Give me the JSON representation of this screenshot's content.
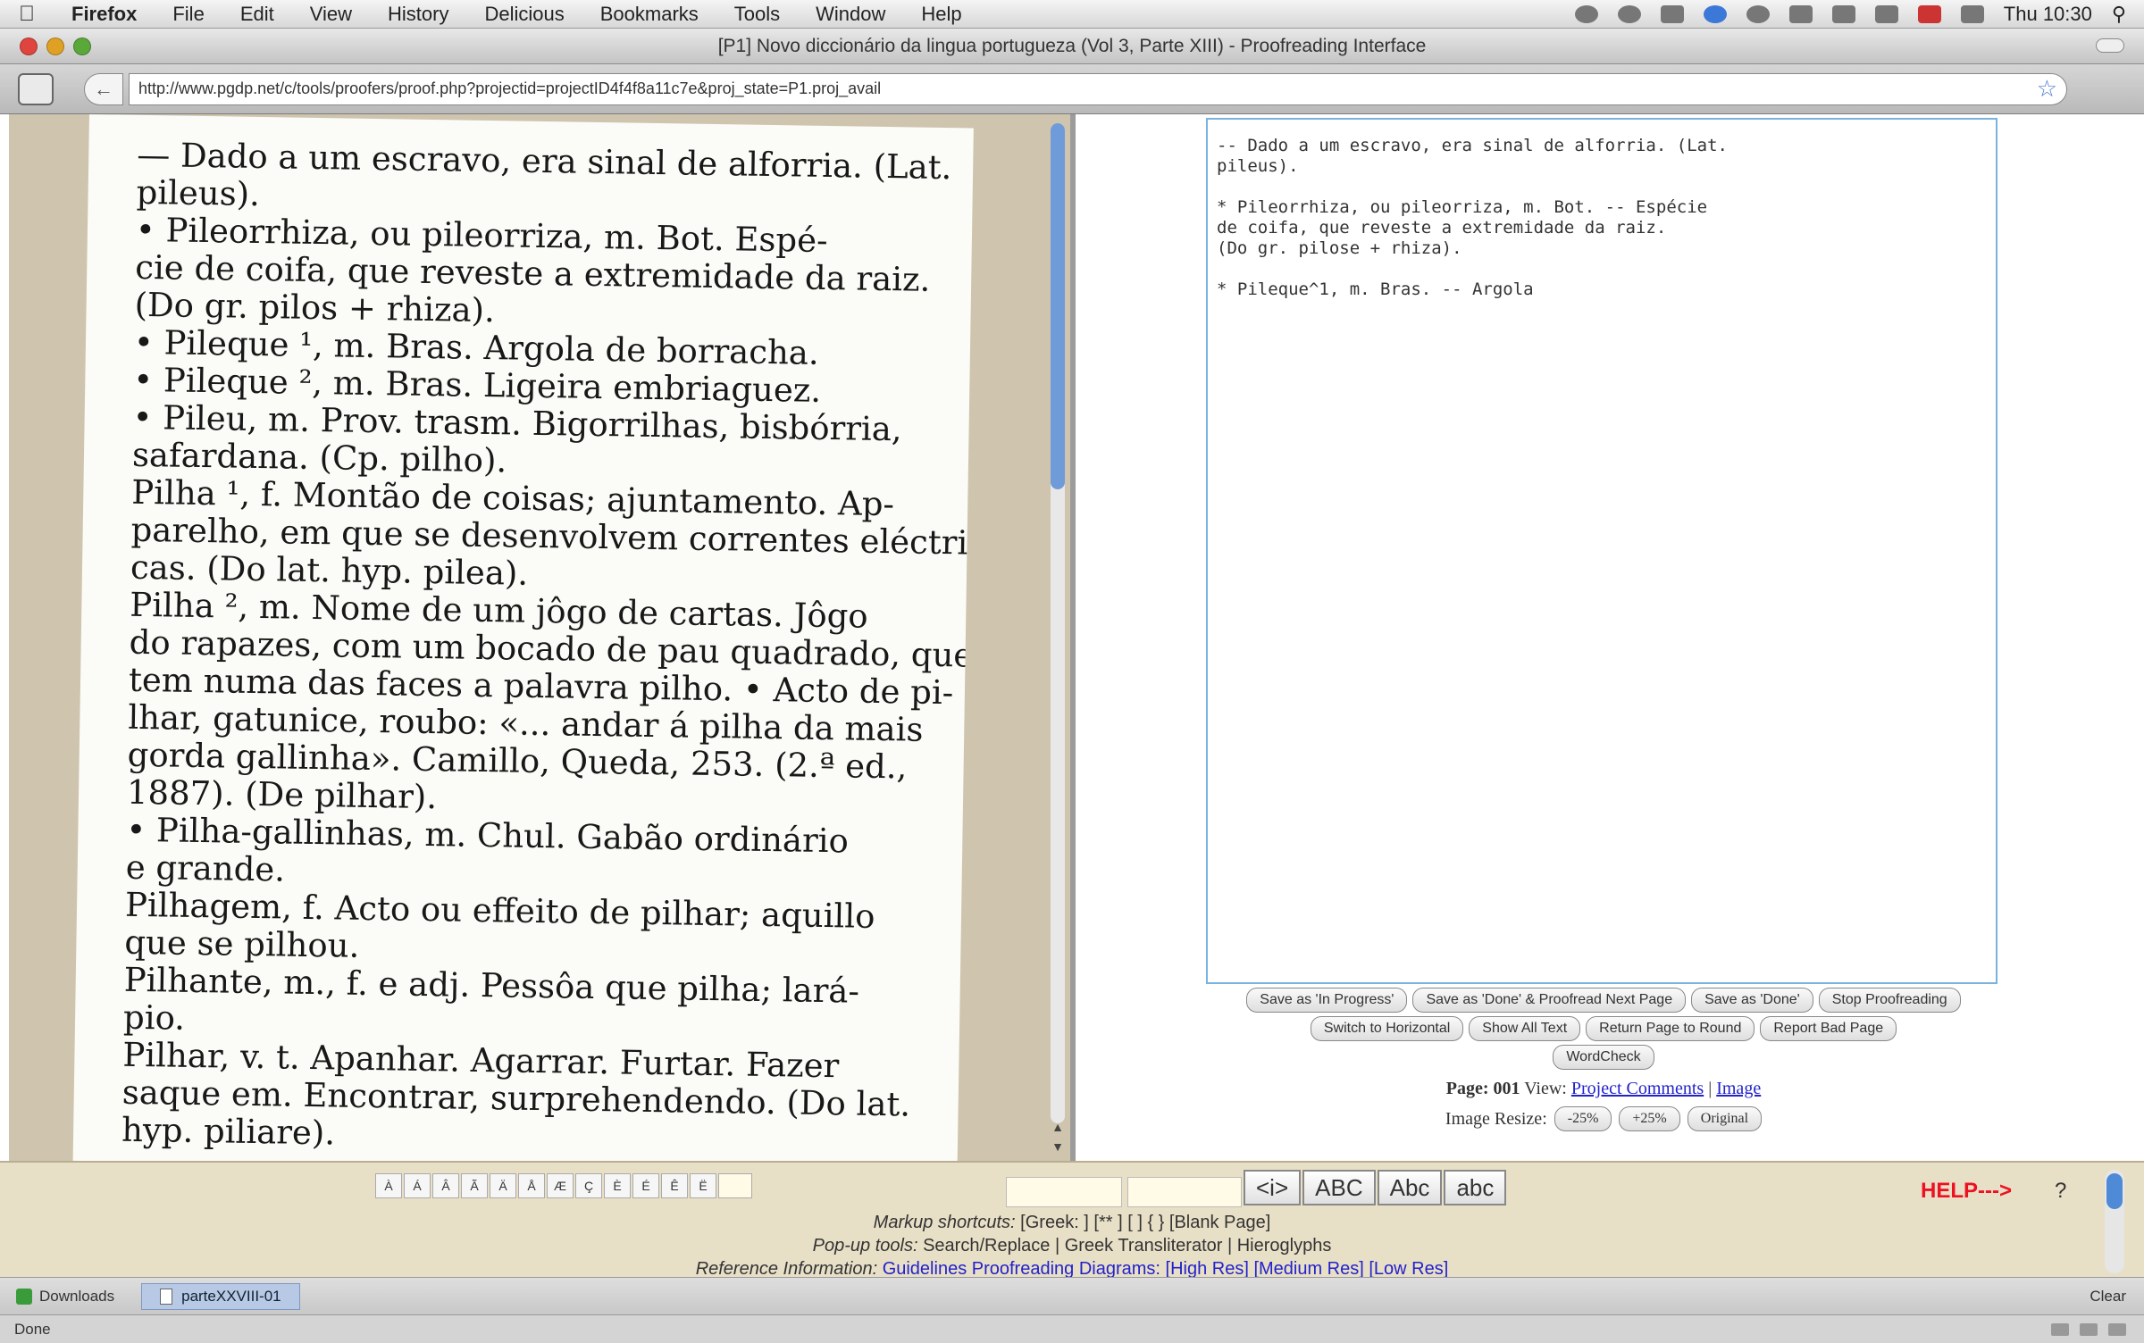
{
  "menubar": {
    "app_name": "Firefox",
    "items": [
      "File",
      "Edit",
      "View",
      "History",
      "Delicious",
      "Bookmarks",
      "Tools",
      "Window",
      "Help"
    ],
    "clock": "Thu 10:30"
  },
  "window": {
    "title": "[P1] Novo diccionário da lingua portugueza (Vol 3, Parte XIII) - Proofreading Interface"
  },
  "toolbar": {
    "url": "http://www.pgdp.net/c/tools/proofers/proof.php?projectid=projectID4f4f8a11c7e&proj_state=P1.proj_avail"
  },
  "scan": {
    "lines": [
      "— Dado a um escravo, era sinal de alforria. (Lat.",
      "pileus).",
      "  • Pileorrhiza, ou pileorriza, m. Bot. Espé-",
      "cie de coifa, que reveste a extremidade da raiz.",
      "(Do gr. pilos + rhiza).",
      "  • Pileque ¹, m. Bras. Argola de borracha.",
      "  • Pileque ², m. Bras. Ligeira embriaguez.",
      "  • Pileu, m. Prov. trasm. Bigorrilhas, bisbórria,",
      "safardana. (Cp. pilho).",
      "   Pilha ¹, f. Montão de coisas; ajuntamento. Ap-",
      "parelho, em que se desenvolvem correntes eléctri-",
      "cas. (Do lat. hyp. pilea).",
      "   Pilha ², m. Nome de um jôgo de cartas. Jôgo",
      "do rapazes, com um bocado de pau quadrado, que",
      "tem numa das faces a palavra pilho. • Acto de pi-",
      "lhar, gatunice, roubo: «... andar á pilha da mais",
      "gorda gallinha». Camillo, Queda, 253. (2.ª ed.,",
      "1887). (De pilhar).",
      "  • Pilha-gallinhas, m. Chul. Gabão ordinário",
      "e grande.",
      "   Pilhagem, f. Acto ou effeito de pilhar; aquillo",
      "que se pilhou.",
      "   Pilhante, m., f. e adj. Pessôa que pilha; lará-",
      "pio.",
      "   Pilhar, v. t. Apanhar. Agarrar. Furtar. Fazer",
      "saque em. Encontrar, surprehendendo. (Do lat.",
      "hyp. piliare)."
    ]
  },
  "editor": {
    "lines": [
      "-- Dado a um escravo, era sinal de alforria. (Lat.",
      "pileus).",
      "",
      "* Pileorrhiza, ou pileorriza, m. Bot. -- Espécie",
      "de coifa, que reveste a extremidade da raiz.",
      "(Do gr. pilose + rhiza).",
      "",
      "* Pileque^1, m. Bras. -- Argola"
    ]
  },
  "buttons": {
    "row1": [
      "Save as 'In Progress'",
      "Save as 'Done' & Proofread Next Page",
      "Save as 'Done'",
      "Stop Proofreading"
    ],
    "row2": [
      "Switch to Horizontal",
      "Show All Text",
      "Return Page to Round",
      "Report Bad Page"
    ],
    "row3": [
      "WordCheck"
    ]
  },
  "page_info": {
    "page_label": "Page: 001",
    "view_label": "View:",
    "project_comments": "Project Comments",
    "separator": "|",
    "image_link": "Image",
    "resize_label": "Image Resize:",
    "resize_buttons": [
      "-25%",
      "+25%",
      "Original"
    ]
  },
  "toolbox": {
    "chars": [
      "À",
      "Á",
      "Â",
      "Ã",
      "Ä",
      "Å",
      "Æ",
      "Ç",
      "È",
      "É",
      "Ê",
      "Ë",
      ""
    ],
    "case_buttons": [
      "<i>",
      "ABC",
      "Abc",
      "abc"
    ],
    "help_link": "HELP--->",
    "help_q": "?",
    "markup_label": "Markup shortcuts:",
    "markup_items": "[Greek: ]   [** ]   [ ]   { }   [Blank Page]",
    "popup_label": "Pop-up tools:",
    "popup_items": "Search/Replace  |  Greek Transliterator  |  Hieroglyphs",
    "reference_label": "Reference Information:",
    "reference_links": "Guidelines  Proofreading Diagrams:  [High Res]  [Medium Res]  [Low Res]"
  },
  "downloads": {
    "label": "Downloads",
    "file": "parteXXVIII-01",
    "clear": "Clear"
  },
  "status": {
    "text": "Done"
  },
  "colors": {
    "help": "#e11122",
    "link": "#2222cc",
    "scan_background": "#cfc4ad",
    "text_border": "#7ab2e0"
  }
}
